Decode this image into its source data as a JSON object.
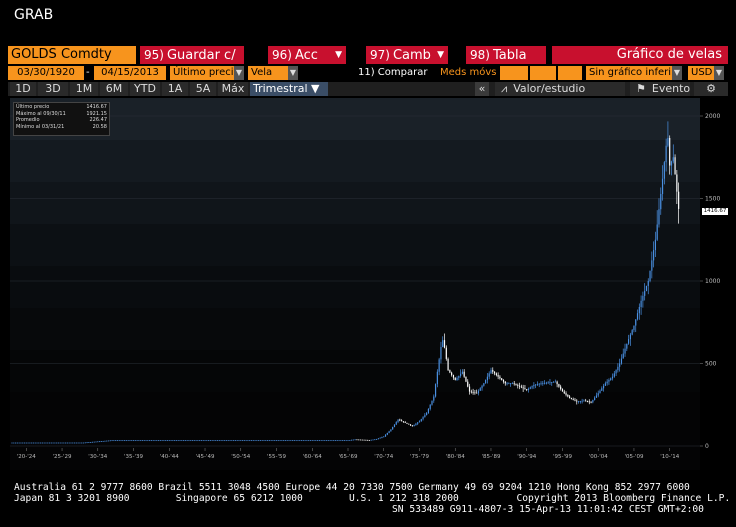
{
  "window": {
    "title": "GRAB"
  },
  "toolbar": {
    "ticker": "GOLDS Comdty",
    "buttons": [
      {
        "num": "95)",
        "label": "Guardar c/"
      },
      {
        "num": "96)",
        "label": "Acc"
      },
      {
        "num": "97)",
        "label": "Camb"
      },
      {
        "num": "98)",
        "label": "Tabla"
      }
    ],
    "chart_type_label": "Gráfico de velas"
  },
  "params": {
    "start_date": "03/30/1920",
    "date_separator": "-",
    "end_date": "04/15/2013",
    "price_field": "Último preci",
    "style": "Vela",
    "compare": "11) Comparar",
    "moving_avgs": "Meds móvs",
    "secondary_chart": "Sin gráfico inferi",
    "currency": "USD"
  },
  "periods": {
    "items": [
      "1D",
      "3D",
      "1M",
      "6M",
      "YTD",
      "1A",
      "5A",
      "Máx"
    ],
    "selected": "Trimestral",
    "collapse": "«",
    "analysis_label": "Valor/estudio",
    "event_label": "Evento",
    "gear": "⚙"
  },
  "legend": {
    "rows": [
      {
        "label": "Último precio",
        "value": "1416.67"
      },
      {
        "label": "Máximo al 09/30/11",
        "value": "1921.15"
      },
      {
        "label": "Promedio",
        "value": "226.47"
      },
      {
        "label": "Mínimo al 03/31/21",
        "value": "20.58"
      }
    ]
  },
  "last_price_tag": "1416.67",
  "colors": {
    "orange": "#f7941d",
    "red": "#c8102e",
    "up": "#4a90e2",
    "down": "#ffffff",
    "plot_bg": "#14181c"
  },
  "chart_data": {
    "type": "candlestick",
    "ylim": [
      0,
      2000
    ],
    "yticks": [
      "0",
      "500",
      "1000",
      "1500",
      "2000"
    ],
    "xticks": [
      "'20-'24",
      "'25-'29",
      "'30-'34",
      "'35-'39",
      "'40-'44",
      "'45-'49",
      "'50-'54",
      "'55-'59",
      "'60-'64",
      "'65-'69",
      "'70-'74",
      "'75-'79",
      "'80-'84",
      "'85-'89",
      "'90-'94",
      "'95-'99",
      "'00-'04",
      "'05-'09",
      "'10-'14"
    ],
    "series": [
      {
        "points": [
          [
            1920,
            20.6
          ],
          [
            1930,
            20.7
          ],
          [
            1934,
            35
          ],
          [
            1940,
            35
          ],
          [
            1950,
            35
          ],
          [
            1960,
            35
          ],
          [
            1967,
            35
          ],
          [
            1968,
            40
          ],
          [
            1970,
            36
          ],
          [
            1971,
            42
          ],
          [
            1972,
            58
          ],
          [
            1973,
            100
          ],
          [
            1974,
            160
          ],
          [
            1975,
            140
          ],
          [
            1976,
            120
          ],
          [
            1977,
            150
          ],
          [
            1978,
            200
          ],
          [
            1979,
            300
          ],
          [
            1979.5,
            450
          ],
          [
            1980,
            600
          ],
          [
            1980.3,
            650
          ],
          [
            1981,
            460
          ],
          [
            1982,
            400
          ],
          [
            1983,
            450
          ],
          [
            1984,
            330
          ],
          [
            1985,
            320
          ],
          [
            1986,
            380
          ],
          [
            1987,
            460
          ],
          [
            1988,
            420
          ],
          [
            1989,
            380
          ],
          [
            1990,
            380
          ],
          [
            1991,
            360
          ],
          [
            1992,
            340
          ],
          [
            1993,
            370
          ],
          [
            1994,
            380
          ],
          [
            1995,
            385
          ],
          [
            1996,
            390
          ],
          [
            1997,
            330
          ],
          [
            1998,
            290
          ],
          [
            1999,
            270
          ],
          [
            2000,
            275
          ],
          [
            2001,
            265
          ],
          [
            2002,
            320
          ],
          [
            2003,
            380
          ],
          [
            2004,
            420
          ],
          [
            2005,
            500
          ],
          [
            2006,
            620
          ],
          [
            2007,
            730
          ],
          [
            2008,
            880
          ],
          [
            2009,
            1000
          ],
          [
            2010,
            1250
          ],
          [
            2011,
            1620
          ],
          [
            2011.7,
            1900
          ],
          [
            2012,
            1700
          ],
          [
            2012.5,
            1750
          ],
          [
            2013.3,
            1416
          ]
        ]
      }
    ],
    "last": 1416.67
  },
  "footer": {
    "line1": "Australia 61 2 9777 8600 Brazil 5511 3048 4500 Europe 44 20 7330 7500 Germany 49 69 9204 1210 Hong Kong 852 2977 6000",
    "line2": "Japan 81 3 3201 8900        Singapore 65 6212 1000        U.S. 1 212 318 2000          Copyright 2013 Bloomberg Finance L.P.",
    "line3": "SN 533489 G911-4807-3 15-Apr-13 11:01:42 CEST GMT+2:00"
  }
}
